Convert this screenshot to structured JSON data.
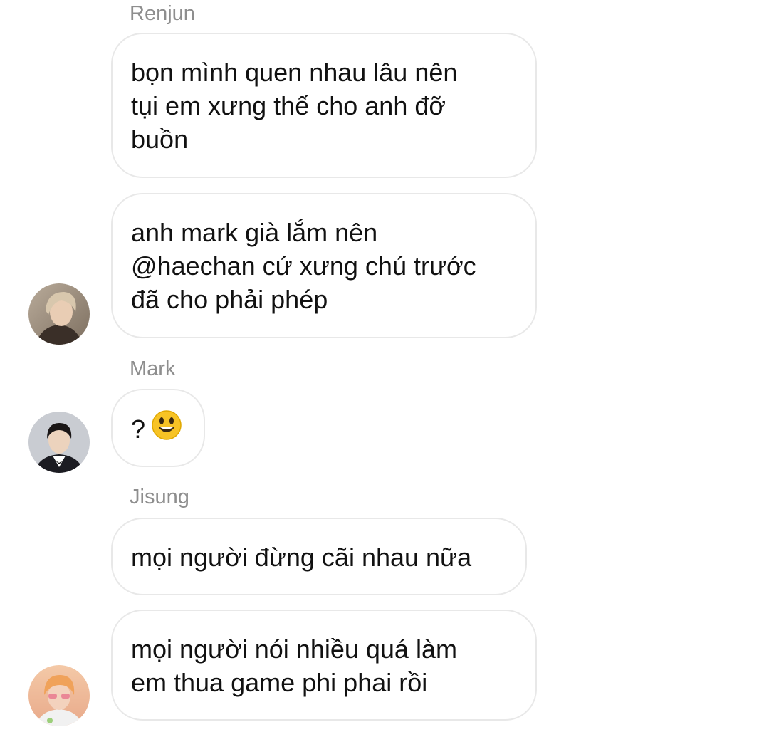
{
  "conversation": {
    "groups": [
      {
        "sender": "Renjun",
        "avatar": "renjun-avatar",
        "messages": [
          {
            "lines": [
              "bọn mình quen nhau lâu nên",
              "tụi em xưng thế cho anh đỡ",
              "buồn"
            ]
          },
          {
            "lines": [
              "anh mark già lắm nên",
              "@haechan cứ xưng chú trước",
              "đã cho phải phép"
            ]
          }
        ]
      },
      {
        "sender": "Mark",
        "avatar": "mark-avatar",
        "messages": [
          {
            "text": "?",
            "emoji": "grinning-face-emoji"
          }
        ]
      },
      {
        "sender": "Jisung",
        "avatar": "jisung-avatar",
        "messages": [
          {
            "lines": [
              "mọi người đừng cãi nhau nữa"
            ]
          },
          {
            "lines": [
              "mọi người nói nhiều quá làm",
              "em thua game phi phai rồi"
            ]
          }
        ]
      }
    ]
  },
  "colors": {
    "bubble_border": "#e8e8e8",
    "sender_name": "#8e8e8e",
    "message_text": "#111111",
    "emoji_yellow": "#f7c325"
  }
}
